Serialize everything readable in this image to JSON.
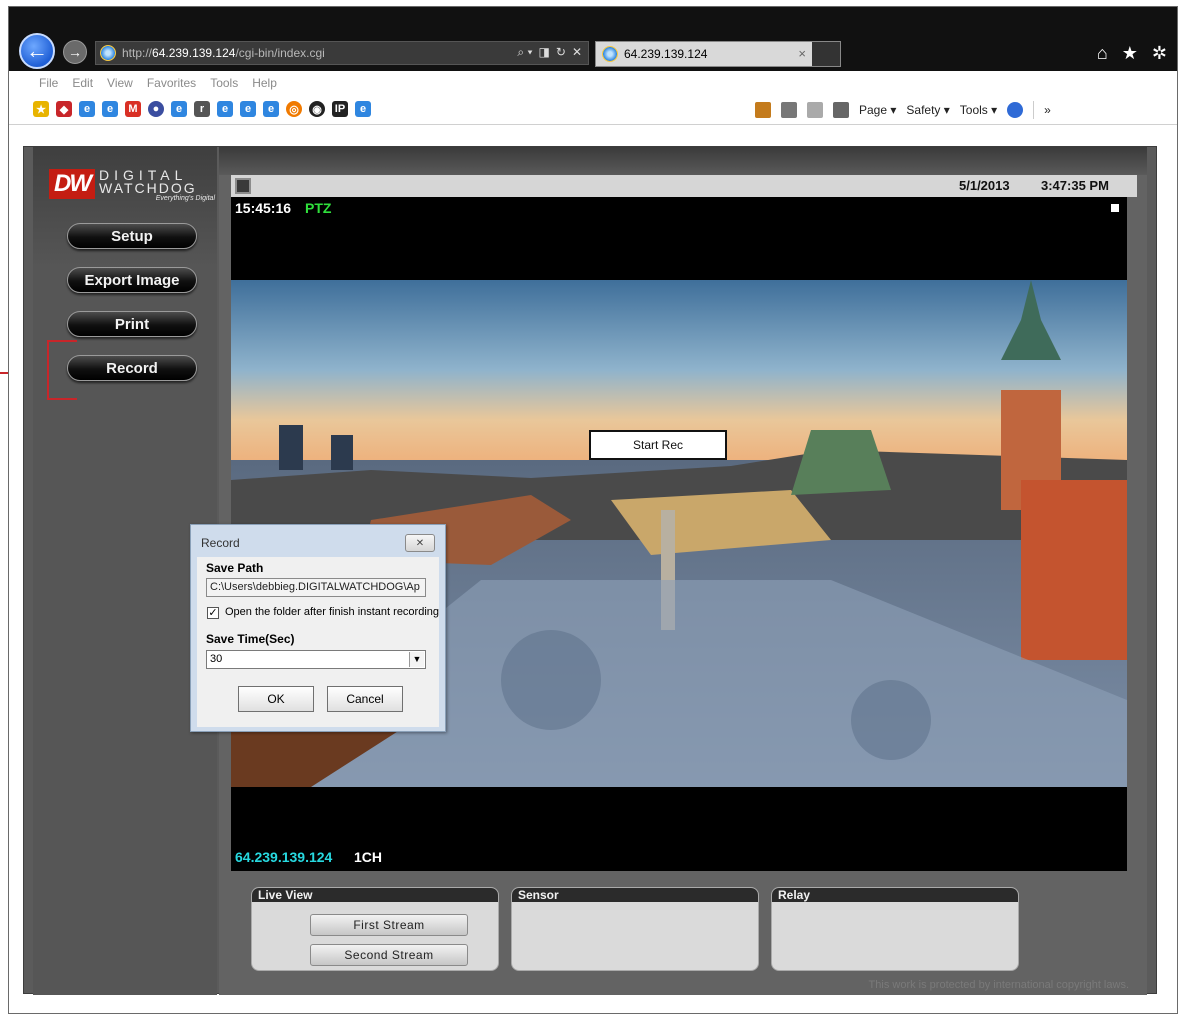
{
  "browser": {
    "url_prefix": "http://",
    "url_host": "64.239.139.124",
    "url_path": "/cgi-bin/index.cgi",
    "address_actions": [
      "⌕ ▾",
      "◨",
      "↻",
      "✕"
    ],
    "tab_title": "64.239.139.124",
    "tab_close": "×",
    "menu": [
      "File",
      "Edit",
      "View",
      "Favorites",
      "Tools",
      "Help"
    ],
    "command_bar": {
      "page": "Page ▾",
      "safety": "Safety ▾",
      "tools": "Tools ▾",
      "more": "»"
    },
    "right_icons": {
      "home": "⌂",
      "favorites": "★",
      "settings": "✲"
    }
  },
  "dvr": {
    "logo": {
      "mark": "DW",
      "line1": "DIGITAL",
      "line2": "WATCHDOG",
      "tagline": "Everything's Digital"
    },
    "sidebar_buttons": {
      "setup": "Setup",
      "export": "Export Image",
      "print": "Print",
      "record": "Record"
    },
    "status": {
      "date": "5/1/2013",
      "time": "3:47:35 PM"
    },
    "video": {
      "osd_time": "15:45:16",
      "osd_mode": "PTZ",
      "start_rec": "Start Rec",
      "ip": "64.239.139.124",
      "channel": "1CH"
    },
    "panels": {
      "live_view": {
        "title": "Live View",
        "first_stream": "First Stream",
        "second_stream": "Second Stream"
      },
      "sensor": {
        "title": "Sensor"
      },
      "relay": {
        "title": "Relay"
      }
    },
    "copyright": "This work is protected by  international copyright laws."
  },
  "record_dialog": {
    "title": "Record",
    "close": "✕",
    "save_path_label": "Save Path",
    "save_path_value": "C:\\Users\\debbieg.DIGITALWATCHDOG\\Ap",
    "open_folder_label": "Open the folder after finish instant recording",
    "open_folder_checked": "✓",
    "save_time_label": "Save Time(Sec)",
    "save_time_value": "30",
    "ok": "OK",
    "cancel": "Cancel"
  },
  "colors": {
    "osd_green": "#2fe03c",
    "osd_cyan": "#27d9e0",
    "callout_red": "#c8262a",
    "logo_red": "#c41d12"
  }
}
